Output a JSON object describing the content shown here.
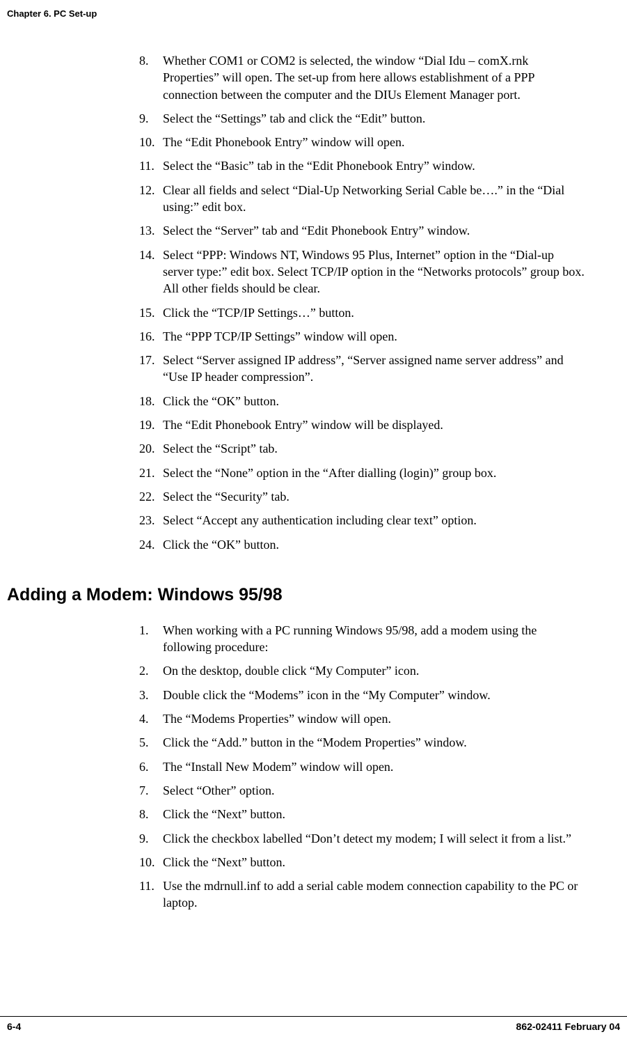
{
  "header": {
    "chapter": "Chapter 6. PC Set-up"
  },
  "list1": [
    {
      "n": "8.",
      "t": "Whether COM1 or COM2 is selected, the window “Dial Idu  – comX.rnk Properties” will open.  The set-up from here allows establishment of a PPP connection between the computer and the DIUs Element Manager port."
    },
    {
      "n": "9.",
      "t": "Select the “Settings” tab and click the “Edit” button."
    },
    {
      "n": "10.",
      "t": "The “Edit Phonebook Entry” window will open."
    },
    {
      "n": "11.",
      "t": "Select the “Basic” tab in the “Edit Phonebook Entry” window."
    },
    {
      "n": "12.",
      "t": "Clear all fields and select “Dial-Up Networking Serial Cable be….” in the “Dial using:” edit box."
    },
    {
      "n": "13.",
      "t": "Select the “Server” tab and “Edit Phonebook Entry” window."
    },
    {
      "n": "14.",
      "t": "Select “PPP: Windows NT, Windows 95 Plus, Internet” option in the “Dial-up server type:” edit box. Select TCP/IP option in the “Networks protocols” group box. All other fields should be clear."
    },
    {
      "n": "15.",
      "t": "Click the “TCP/IP Settings…” button."
    },
    {
      "n": "16.",
      "t": "The “PPP TCP/IP Settings” window will open."
    },
    {
      "n": "17.",
      "t": "Select “Server assigned IP address”, “Server assigned name server address” and “Use IP header compression”."
    },
    {
      "n": "18.",
      "t": "Click the “OK” button."
    },
    {
      "n": "19.",
      "t": "The “Edit Phonebook Entry” window will be displayed."
    },
    {
      "n": "20.",
      "t": "Select the “Script” tab."
    },
    {
      "n": "21.",
      "t": "Select the “None” option in the “After dialling (login)” group box."
    },
    {
      "n": "22.",
      "t": "Select the “Security” tab."
    },
    {
      "n": "23.",
      "t": "Select “Accept any authentication including clear text” option."
    },
    {
      "n": "24.",
      "t": "Click the “OK” button."
    }
  ],
  "section2": {
    "heading": "Adding a Modem: Windows 95/98"
  },
  "list2": [
    {
      "n": "1.",
      "t": "When working with a PC running Windows 95/98, add a modem using the following procedure:"
    },
    {
      "n": "2.",
      "t": "On the desktop, double click “My Computer” icon."
    },
    {
      "n": "3.",
      "t": "Double click the “Modems” icon in the “My Computer” window."
    },
    {
      "n": "4.",
      "t": "The “Modems Properties” window will open."
    },
    {
      "n": "5.",
      "t": "Click the “Add.” button in the “Modem Properties” window."
    },
    {
      "n": "6.",
      "t": "The “Install New Modem” window will open."
    },
    {
      "n": "7.",
      "t": "Select “Other” option."
    },
    {
      "n": "8.",
      "t": "Click the “Next” button."
    },
    {
      "n": "9.",
      "t": "Click the checkbox labelled “Don’t detect my modem; I will select it from a list.”"
    },
    {
      "n": "10.",
      "t": "Click the “Next” button."
    },
    {
      "n": "11.",
      "t": "Use the mdrnull.inf to add a serial cable modem connection capability to the PC or laptop."
    }
  ],
  "footer": {
    "page": "6-4",
    "docref": "862-02411 February 04"
  }
}
